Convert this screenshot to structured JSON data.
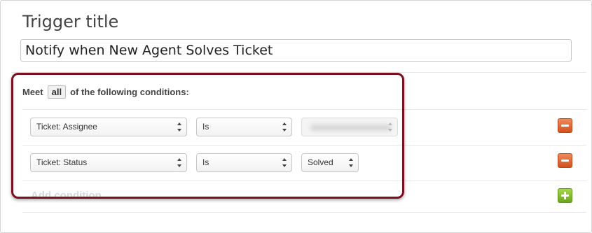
{
  "trigger": {
    "title_label": "Trigger title",
    "title_value": "Notify when New Agent Solves Ticket"
  },
  "conditions": {
    "meet_prefix": "Meet",
    "meet_selector": "all",
    "meet_suffix": "of the following conditions:",
    "rows": [
      {
        "field": "Ticket: Assignee",
        "operator": "Is",
        "value": ""
      },
      {
        "field": "Ticket: Status",
        "operator": "Is",
        "value": "Solved"
      }
    ],
    "add_label": "Add condition"
  },
  "icons": {
    "remove": "minus-icon",
    "add": "plus-icon"
  },
  "colors": {
    "highlight_border": "#7a1020",
    "remove_button": "#e0622f",
    "add_button": "#88c232"
  }
}
